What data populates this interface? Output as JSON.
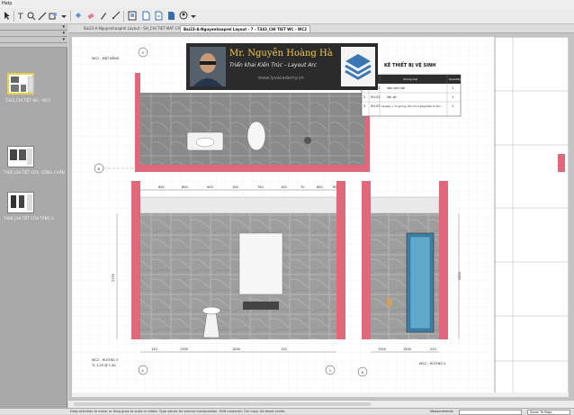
{
  "menu": {
    "help_label": "Help"
  },
  "toolbar": {
    "icons": [
      "select-tool",
      "text-tool",
      "line-tool",
      "arc-tool",
      "shapes-tool",
      "paint-bucket",
      "eraser",
      "style-tool",
      "measure-tool",
      "scrapbook-tool",
      "page-add",
      "page-delete",
      "page-copy",
      "user-tool"
    ]
  },
  "tabs": [
    {
      "label": "Bai23-A-Nguyenhaaprel Layout - SH_CHI TIET MAT CAT"
    },
    {
      "label": "Bai23-A-Nguyenhaaprel Layout - 7 - T343_CHI TIET WC - WC2"
    }
  ],
  "pages": [
    {
      "label": "T343_CHI TIẾT WC - WC2"
    },
    {
      "label": "T408_CHI TIẾT CỬA, CỔNG, CHẮN"
    },
    {
      "label": "T408_CHI TIẾT CỬA TẦNG 3"
    }
  ],
  "drawing": {
    "plan_title": "WC2 - MẶT BẰNG",
    "section3_title": "WC2 - HƯỚNG 3",
    "section4_title": "WC2 - HƯỚNG 4",
    "grid_3": "3",
    "grid_4": "4",
    "grid_b": "B",
    "grid_3b": "3",
    "dims_top": [
      "650",
      "800",
      "900",
      "100",
      "750",
      "100",
      "70",
      "650",
      "900"
    ],
    "dims_bottom": [
      "120",
      "1300",
      "1000",
      "120",
      "1300",
      "1500",
      "220"
    ],
    "dim_right": "2850",
    "dim_left": "2750",
    "scale_note": "TL 1:25 @ 1:40"
  },
  "schedule": {
    "title": "KÊ THIẾT BỊ VỆ SINH",
    "headers": [
      "",
      "Mã",
      "Chủng loại",
      "Quantity"
    ],
    "rows": [
      [
        "1",
        "SH-01",
        "Van sen vòi",
        "1"
      ],
      [
        "2",
        "SH-02",
        "Vòi xịt",
        "1"
      ],
      [
        "3",
        "SH-03",
        "Lavabo + Tủ gương, Hộc Kính giấy/khăn tủ kho",
        "1"
      ]
    ]
  },
  "promo": {
    "name": "Mr. Nguyễn Hoàng Hà",
    "subtitle": "Triển khai Kiến Trúc - Layout Arc",
    "website": "www.lyvacademy.vn"
  },
  "status": {
    "text": "Drag selection to move, or drag grips to scale or rotate. Type values for precise manipulation. Shift constrain: Ctrl copy. Alt about center.",
    "measurements_label": "Measurements",
    "zoom_label": "Zoom To Page"
  },
  "colors": {
    "wall_pink": "#e0687a",
    "toolbar_bg": "#ececec",
    "left_panel": "#a9a9a9",
    "promo_gold": "#f2c94c",
    "logo_blue": "#3a78b5"
  }
}
